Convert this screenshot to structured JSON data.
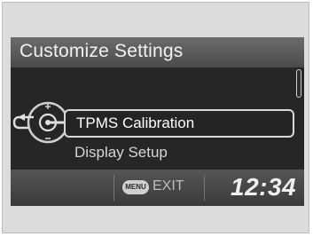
{
  "header": {
    "title": "Customize Settings"
  },
  "menu": {
    "items": [
      {
        "label": "TPMS Calibration",
        "selected": true
      },
      {
        "label": "Display Setup",
        "selected": false
      }
    ]
  },
  "footer": {
    "menu_badge": "MENU",
    "exit_label": "EXIT",
    "clock": "12:34"
  },
  "icons": {
    "selector_knob": "selector-knob-icon",
    "back_arrow": "back-arrow-icon",
    "down_arrow": "down-arrow-icon",
    "scrollbar": "scrollbar"
  },
  "colors": {
    "screen_bg": "#262626",
    "title_bar": "#5a5a5a",
    "highlight_border": "#d8d8d8",
    "text": "#ffffff"
  }
}
